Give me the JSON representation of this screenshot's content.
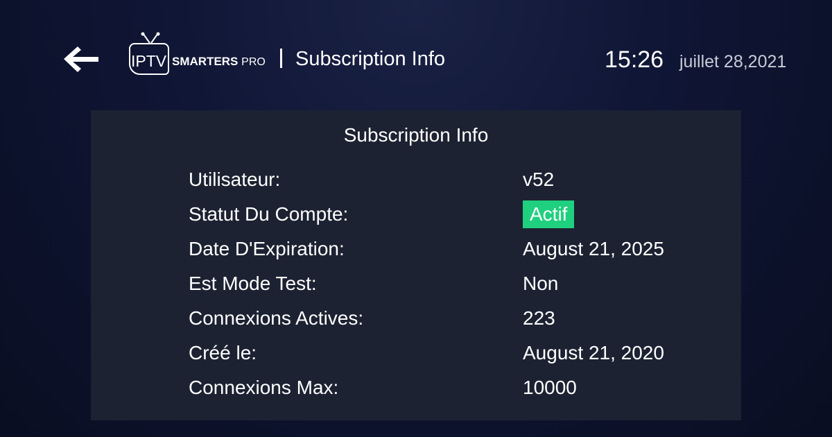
{
  "header": {
    "back_icon": "arrow-left-icon",
    "logo": {
      "iptv": "IPTV",
      "smarters": "SMARTERS",
      "pro": "PRO"
    },
    "divider": "|",
    "title": "Subscription Info",
    "time": "15:26",
    "date": "juillet 28,2021"
  },
  "panel": {
    "title": "Subscription Info",
    "rows": [
      {
        "label": "Utilisateur:",
        "value": "v52"
      },
      {
        "label": "Statut Du Compte:",
        "value": "Actif"
      },
      {
        "label": "Date D'Expiration:",
        "value": "August 21, 2025"
      },
      {
        "label": "Est Mode Test:",
        "value": "Non"
      },
      {
        "label": "Connexions Actives:",
        "value": "223"
      },
      {
        "label": "Créé le:",
        "value": "August 21, 2020"
      },
      {
        "label": "Connexions Max:",
        "value": "10000"
      }
    ]
  },
  "colors": {
    "background": "#0f1534",
    "panel": "#1c2232",
    "status_active": "#1fd07e",
    "date_text": "#c8cbd6"
  }
}
